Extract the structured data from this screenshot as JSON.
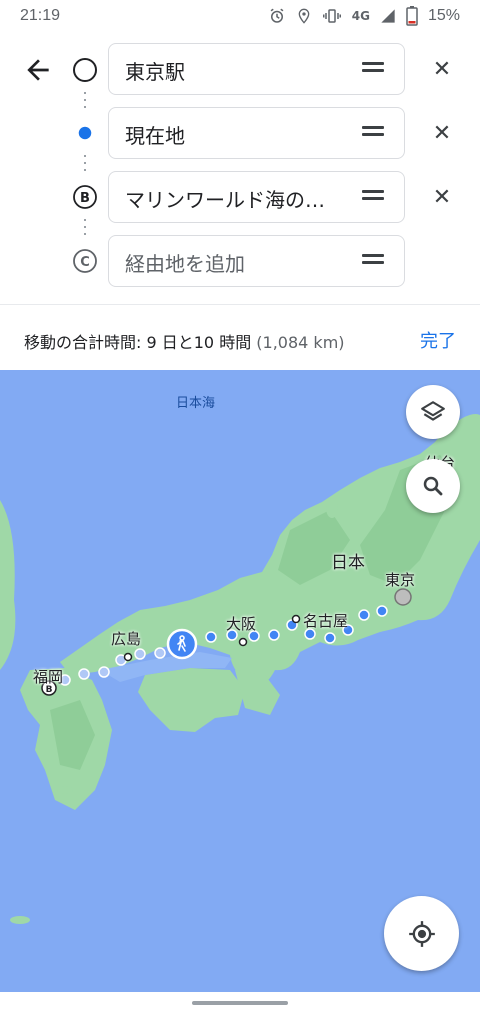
{
  "status_bar": {
    "time": "21:19",
    "network": "4G",
    "battery": "15%",
    "icons": [
      "alarm-icon",
      "location-icon",
      "vibrate-icon",
      "signal-icon",
      "battery-icon"
    ]
  },
  "directions": {
    "waypoints": [
      {
        "value": "東京駅",
        "placeholder": false,
        "marker": "origin-circle"
      },
      {
        "value": "現在地",
        "placeholder": false,
        "marker": "current-location-dot"
      },
      {
        "value": "マリンワールド海の…",
        "placeholder": false,
        "marker": "B"
      },
      {
        "value": "経由地を追加",
        "placeholder": true,
        "marker": "C"
      }
    ],
    "summary_label": "移動の合計時間: 9 日と10 時間",
    "distance": "(1,084 km)",
    "done_label": "完了"
  },
  "map": {
    "sea_label": "日本海",
    "labels": {
      "sendai": "仙台",
      "japan": "日本",
      "tokyo": "東京",
      "nagoya": "名古屋",
      "osaka": "大阪",
      "hiroshima": "広島",
      "fukuoka": "福岡"
    },
    "marker_b": "B",
    "colors": {
      "sea": "#82aaf3",
      "land": "#9fd8a7",
      "route": "#4285f4",
      "accent": "#1a73e8"
    }
  }
}
